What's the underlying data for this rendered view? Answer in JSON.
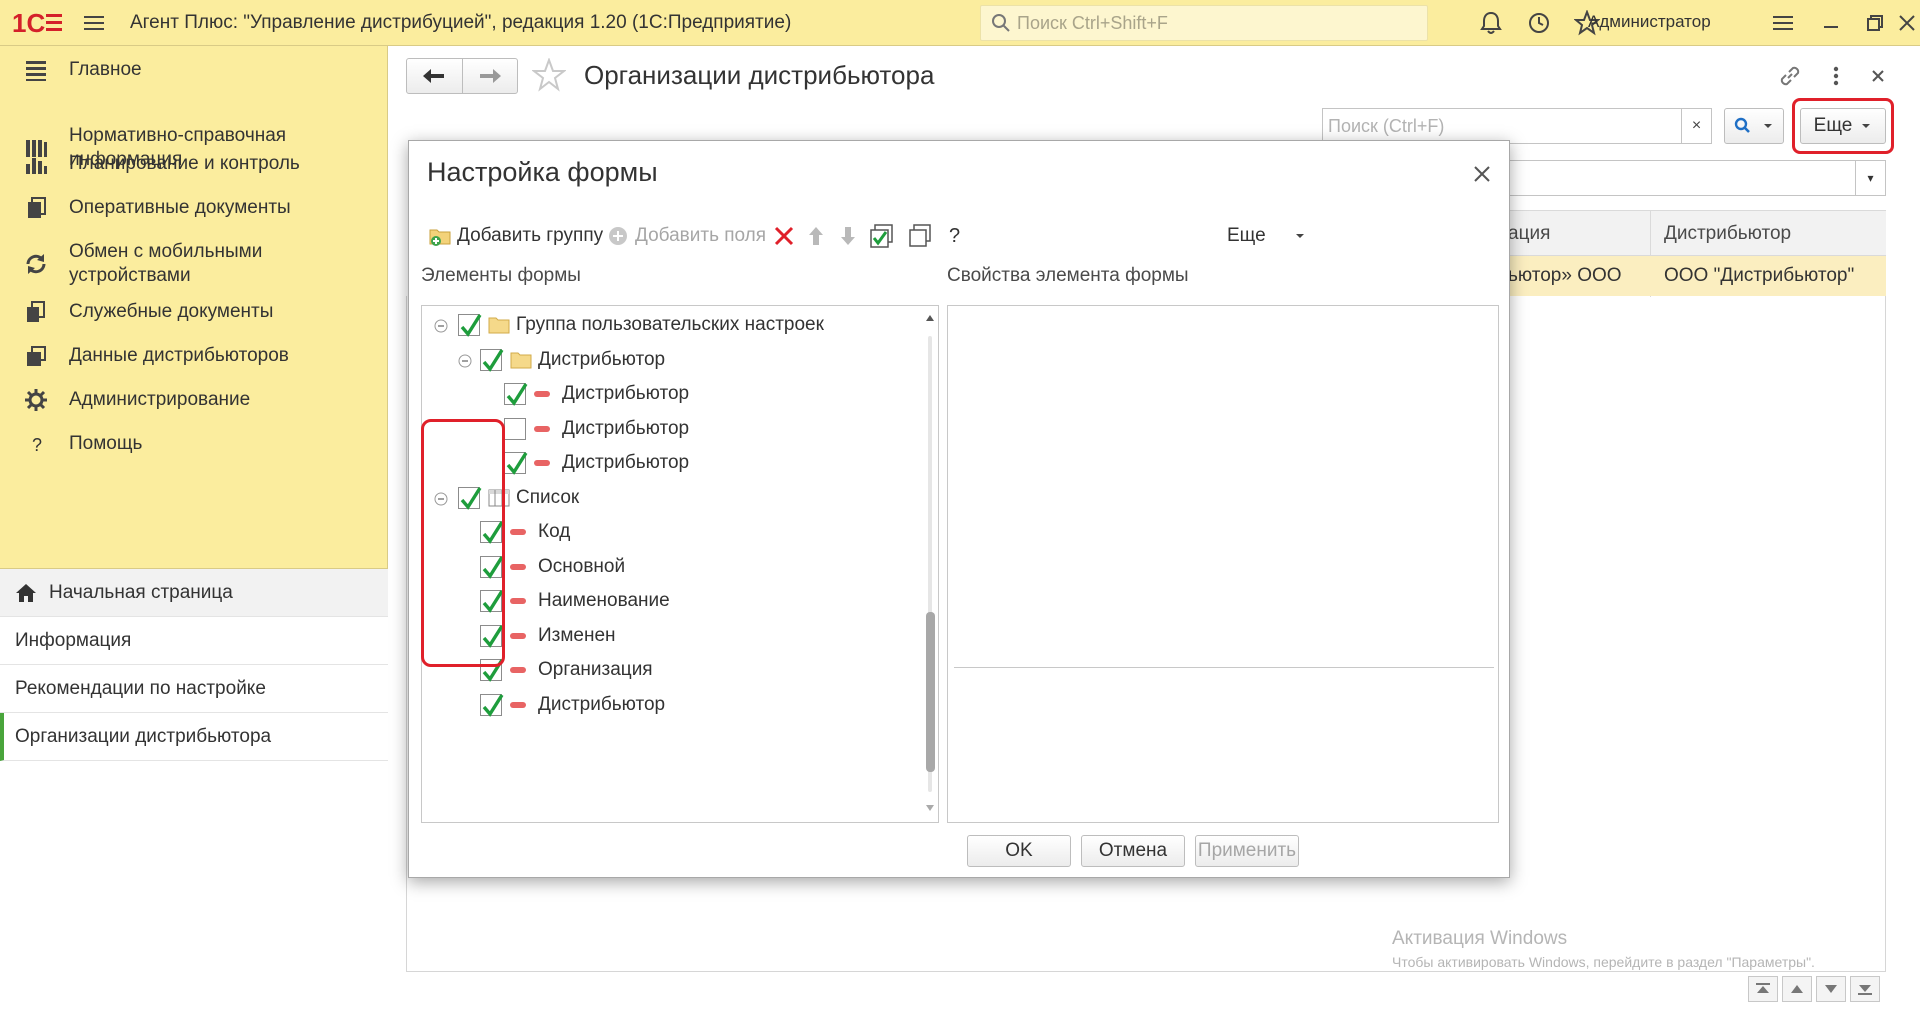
{
  "app": {
    "title": "Агент Плюс: \"Управление дистрибуцией\", редакция 1.20  (1С:Предприятие)",
    "search_placeholder": "Поиск Ctrl+Shift+F",
    "user": "Администратор"
  },
  "sidebar": {
    "items": [
      {
        "label": "Главное",
        "icon": "list-icon"
      },
      {
        "label": "Нормативно-справочная информация",
        "icon": "books-icon"
      },
      {
        "label": "Планирование и контроль",
        "icon": "bar-chart-icon"
      },
      {
        "label": "Оперативные документы",
        "icon": "documents-icon"
      },
      {
        "label": "Обмен с мобильными устройствами",
        "icon": "sync-icon"
      },
      {
        "label": "Служебные документы",
        "icon": "service-docs-icon"
      },
      {
        "label": "Данные дистрибьюторов",
        "icon": "distributor-data-icon"
      },
      {
        "label": "Администрирование",
        "icon": "gear-icon"
      },
      {
        "label": "Помощь",
        "icon": "question-icon"
      }
    ],
    "open_windows": [
      {
        "label": "Начальная страница",
        "icon": "home-icon"
      },
      {
        "label": "Информация"
      },
      {
        "label": "Рекомендации по настройке"
      },
      {
        "label": "Организации дистрибьютора"
      }
    ]
  },
  "form": {
    "title": "Организации дистрибьютора",
    "search_placeholder": "Поиск (Ctrl+F)",
    "clear_label": "×",
    "more_label": "Еще",
    "columns": [
      "ация",
      "Дистрибьютор"
    ],
    "rows": [
      [
        "ьютор» ООО",
        "ООО \"Дистрибьютор\""
      ]
    ]
  },
  "dialog": {
    "title": "Настройка формы",
    "toolbar": {
      "add_group": "Добавить группу",
      "add_fields": "Добавить поля",
      "help": "?",
      "more": "Еще"
    },
    "elements_label": "Элементы формы",
    "properties_label": "Свойства элемента формы",
    "tree": [
      {
        "label": "Группа пользовательских настроек",
        "checked": true
      },
      {
        "label": "Дистрибьютор",
        "checked": true
      },
      {
        "label": "Дистрибьютор",
        "checked": true
      },
      {
        "label": "Дистрибьютор",
        "checked": false
      },
      {
        "label": "Дистрибьютор",
        "checked": true
      },
      {
        "label": "Список",
        "checked": true
      },
      {
        "label": "Код",
        "checked": true
      },
      {
        "label": "Основной",
        "checked": true
      },
      {
        "label": "Наименование",
        "checked": true
      },
      {
        "label": "Изменен",
        "checked": true
      },
      {
        "label": "Организация",
        "checked": true
      },
      {
        "label": "Дистрибьютор",
        "checked": true
      }
    ],
    "buttons": {
      "ok": "OK",
      "cancel": "Отмена",
      "apply": "Применить"
    }
  },
  "watermark": {
    "title": "Активация Windows",
    "subtitle": "Чтобы активировать Windows, перейдите в раздел \"Параметры\"."
  },
  "colors": {
    "panel": "#fbed9e",
    "selected_row": "#fbeec0",
    "check_green": "#1e9d3c",
    "highlight_red": "#e0202a"
  }
}
